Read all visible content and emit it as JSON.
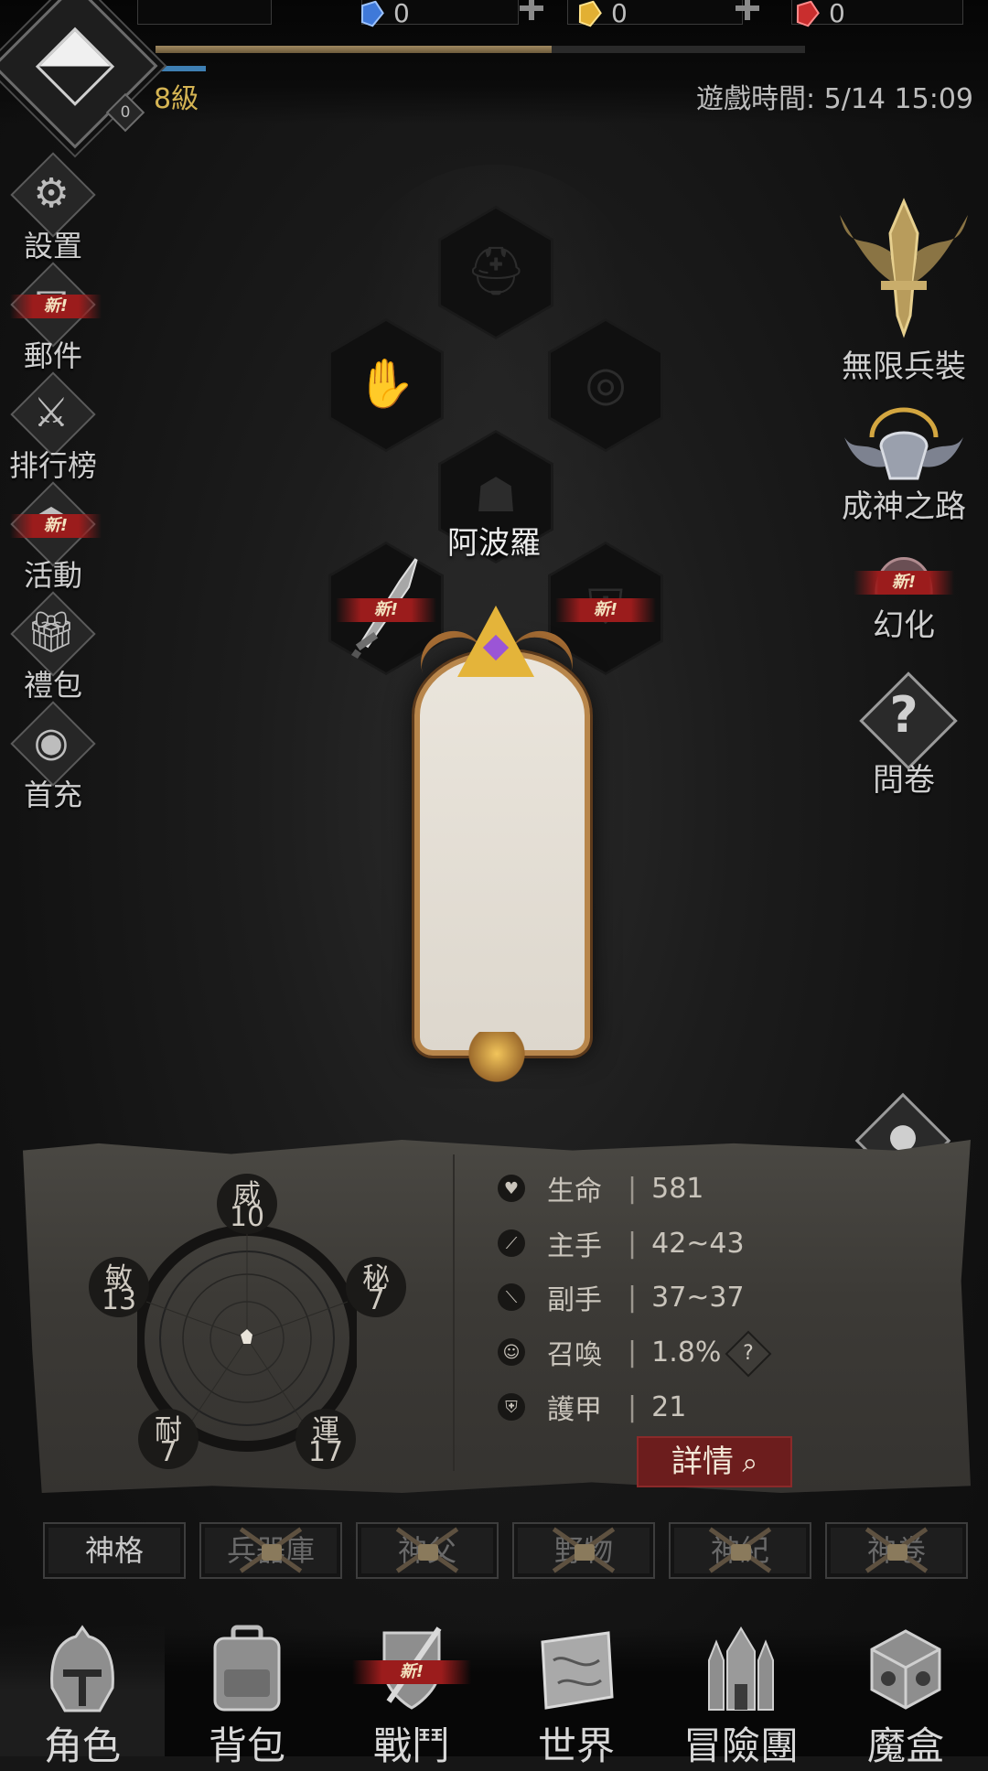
{
  "top": {
    "level": "8級",
    "level_badge": "0",
    "play_time": "遊戲時間: 5/14 15:09",
    "xp_fraction": 0.61,
    "currencies": [
      {
        "name": "blue-gem",
        "value": "0",
        "color": "#3f79d9"
      },
      {
        "name": "gold-gem",
        "value": "0",
        "color": "#e2b033"
      },
      {
        "name": "red-gem",
        "value": "0",
        "color": "#c92e2e"
      }
    ]
  },
  "left_menu": {
    "settings": "設置",
    "mail": "郵件",
    "ranking": "排行榜",
    "events": "活動",
    "gift": "禮包",
    "first_charge": "首充",
    "new_tag": "新!"
  },
  "right_menu": {
    "infinite_arms": "無限兵裝",
    "path_to_godhood": "成神之路",
    "transform": "幻化",
    "survey": "問卷",
    "new_tag": "新!"
  },
  "hero": {
    "name": "阿波羅"
  },
  "equipment_new_tag": "新!",
  "attributes": {
    "wei": {
      "name": "威",
      "value": "10"
    },
    "mi": {
      "name": "秘",
      "value": "7"
    },
    "yun": {
      "name": "運",
      "value": "17"
    },
    "nai": {
      "name": "耐",
      "value": "7"
    },
    "min": {
      "name": "敏",
      "value": "13"
    }
  },
  "stats": [
    {
      "label": "生命",
      "value": "581"
    },
    {
      "label": "主手",
      "value": "42~43"
    },
    {
      "label": "副手",
      "value": "37~37"
    },
    {
      "label": "召喚",
      "value": "1.8%"
    },
    {
      "label": "護甲",
      "value": "21"
    }
  ],
  "stat_separator": "|",
  "help_mark": "?",
  "detail_button": "詳情",
  "sub_tabs": [
    "神格",
    "兵器庫",
    "神父",
    "野物",
    "神紀",
    "神卷"
  ],
  "bottom_nav": {
    "character": "角色",
    "backpack": "背包",
    "battle": "戰鬥",
    "world": "世界",
    "adventure_team": "冒險團",
    "magic_box": "魔盒",
    "new_tag": "新!"
  },
  "colors": {
    "accent_gold": "#d5b453",
    "new_red": "#9b1c1c",
    "detail_red": "#6c1d1d"
  }
}
